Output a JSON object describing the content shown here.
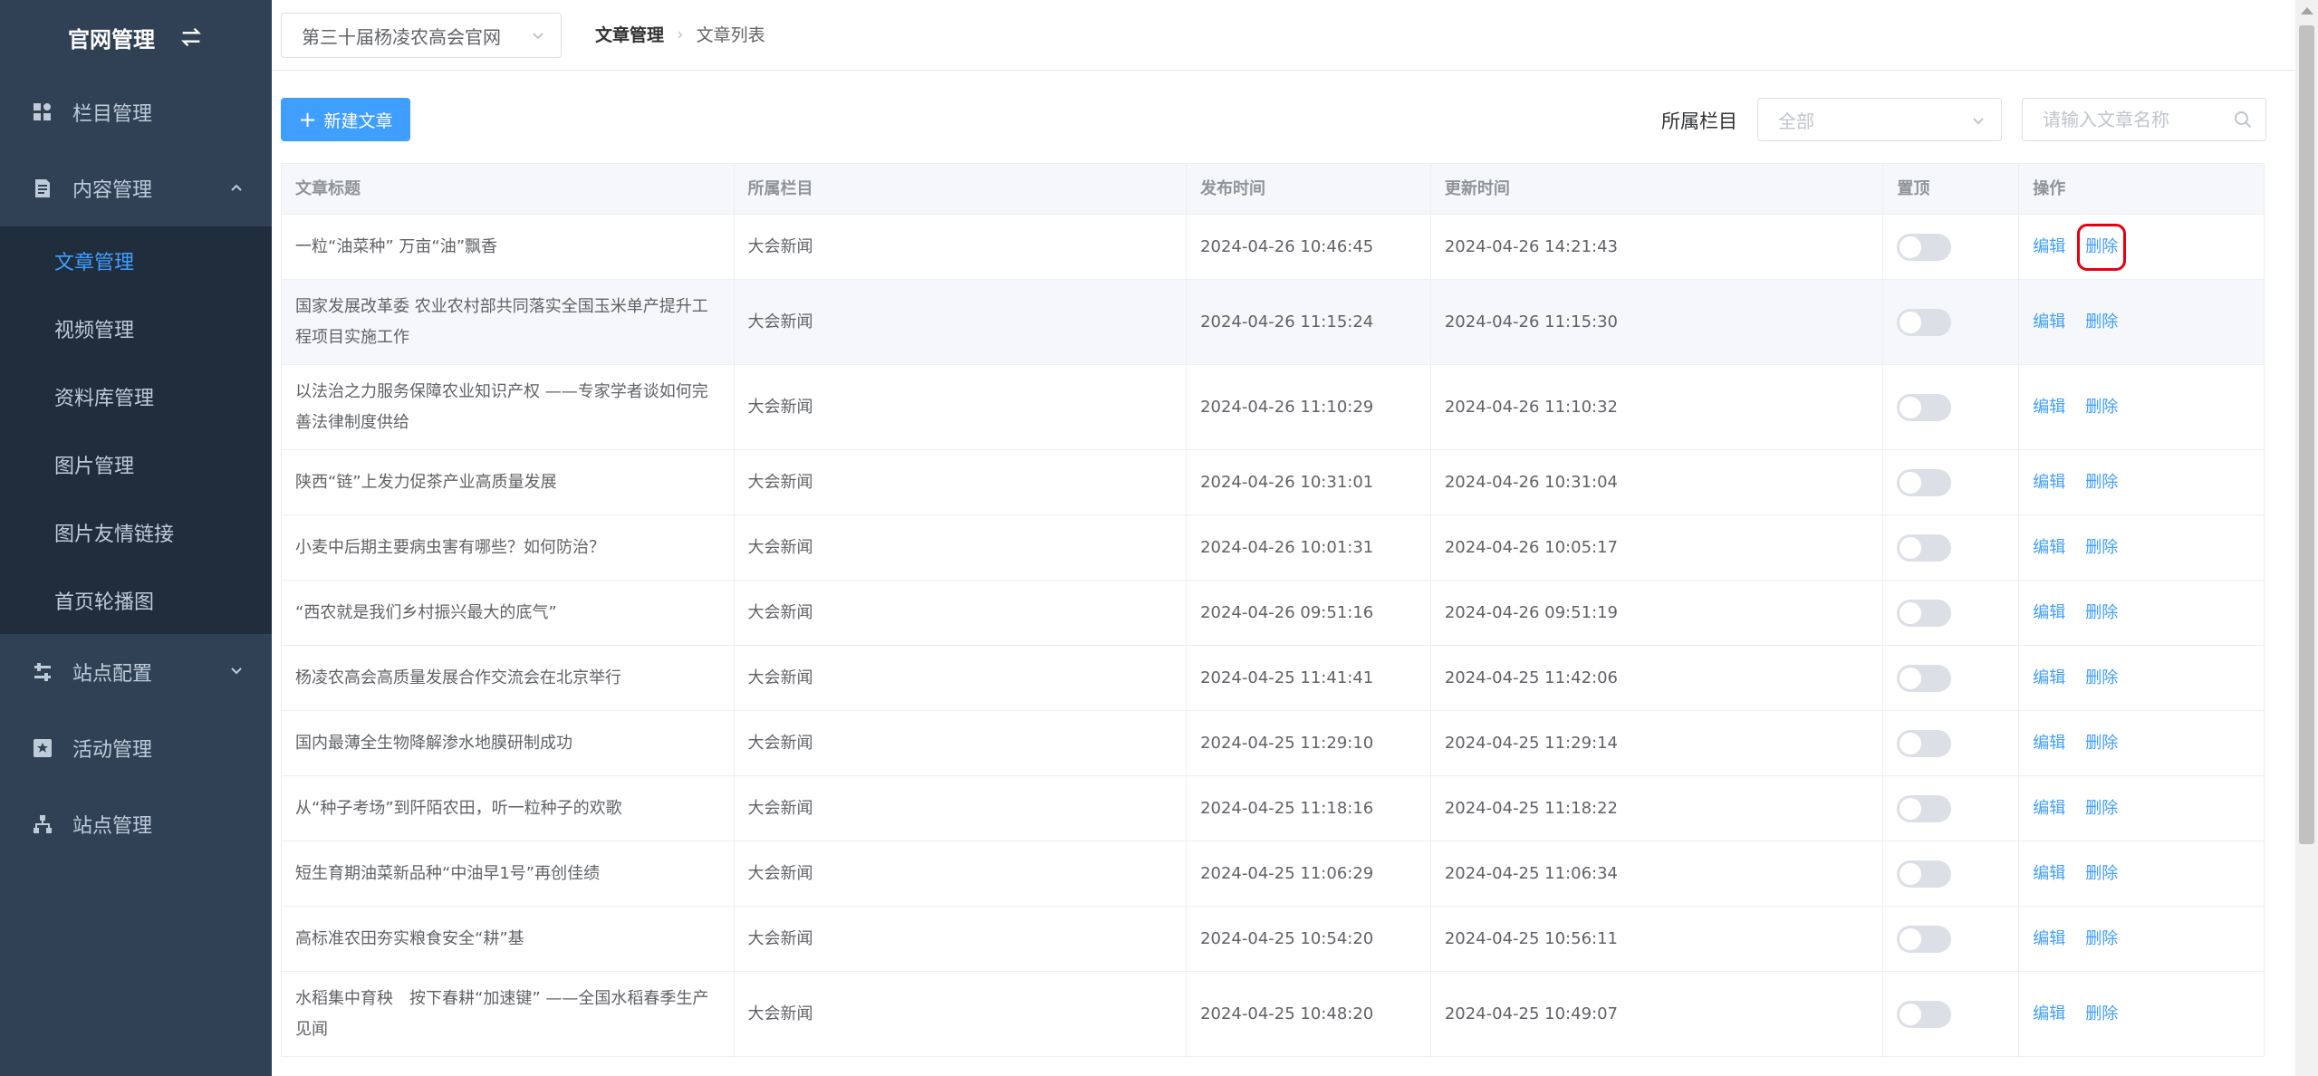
{
  "sidebar": {
    "title": "官网管理",
    "icons": {
      "swap": "swap-icon"
    },
    "menus": [
      {
        "label": "栏目管理",
        "icon": "grid-icon"
      },
      {
        "label": "内容管理",
        "icon": "document-icon"
      },
      {
        "label": "站点配置",
        "icon": "sliders-icon"
      },
      {
        "label": "活动管理",
        "icon": "star-box-icon"
      },
      {
        "label": "站点管理",
        "icon": "sitemap-icon"
      }
    ],
    "content_sub": [
      "文章管理",
      "视频管理",
      "资料库管理",
      "图片管理",
      "图片友情链接",
      "首页轮播图"
    ],
    "active_sub": "文章管理"
  },
  "topbar": {
    "site_select": "第三十届杨凌农高会官网",
    "breadcrumb": [
      "文章管理",
      "文章列表"
    ]
  },
  "toolbar": {
    "new_button": "新建文章",
    "filter_label": "所属栏目",
    "filter_value": "全部",
    "search_placeholder": "请输入文章名称"
  },
  "table": {
    "headers": [
      "文章标题",
      "所属栏目",
      "发布时间",
      "更新时间",
      "置顶",
      "操作"
    ],
    "edit_label": "编辑",
    "delete_label": "删除",
    "rows": [
      {
        "title": "一粒“油菜种” 万亩“油”飘香",
        "column": "大会新闻",
        "published": "2024-04-26 10:46:45",
        "updated": "2024-04-26 14:21:43",
        "pinned": false
      },
      {
        "title": "国家发展改革委 农业农村部共同落实全国玉米单产提升工程项目实施工作",
        "column": "大会新闻",
        "published": "2024-04-26 11:15:24",
        "updated": "2024-04-26 11:15:30",
        "pinned": false
      },
      {
        "title": "以法治之力服务保障农业知识产权 ——专家学者谈如何完善法律制度供给",
        "column": "大会新闻",
        "published": "2024-04-26 11:10:29",
        "updated": "2024-04-26 11:10:32",
        "pinned": false
      },
      {
        "title": "陕西“链”上发力促茶产业高质量发展",
        "column": "大会新闻",
        "published": "2024-04-26 10:31:01",
        "updated": "2024-04-26 10:31:04",
        "pinned": false
      },
      {
        "title": "小麦中后期主要病虫害有哪些？如何防治？",
        "column": "大会新闻",
        "published": "2024-04-26 10:01:31",
        "updated": "2024-04-26 10:05:17",
        "pinned": false
      },
      {
        "title": "“西农就是我们乡村振兴最大的底气”",
        "column": "大会新闻",
        "published": "2024-04-26 09:51:16",
        "updated": "2024-04-26 09:51:19",
        "pinned": false
      },
      {
        "title": "杨凌农高会高质量发展合作交流会在北京举行",
        "column": "大会新闻",
        "published": "2024-04-25 11:41:41",
        "updated": "2024-04-25 11:42:06",
        "pinned": false
      },
      {
        "title": "国内最薄全生物降解渗水地膜研制成功",
        "column": "大会新闻",
        "published": "2024-04-25 11:29:10",
        "updated": "2024-04-25 11:29:14",
        "pinned": false
      },
      {
        "title": "从“种子考场”到阡陌农田，听一粒种子的欢歌",
        "column": "大会新闻",
        "published": "2024-04-25 11:18:16",
        "updated": "2024-04-25 11:18:22",
        "pinned": false
      },
      {
        "title": "短生育期油菜新品种“中油早1号”再创佳绩",
        "column": "大会新闻",
        "published": "2024-04-25 11:06:29",
        "updated": "2024-04-25 11:06:34",
        "pinned": false
      },
      {
        "title": "高标准农田夯实粮食安全“耕”基",
        "column": "大会新闻",
        "published": "2024-04-25 10:54:20",
        "updated": "2024-04-25 10:56:11",
        "pinned": false
      },
      {
        "title": "水稻集中育秧　按下春耕“加速键” ——全国水稻春季生产见闻",
        "column": "大会新闻",
        "published": "2024-04-25 10:48:20",
        "updated": "2024-04-25 10:49:07",
        "pinned": false
      }
    ]
  },
  "colors": {
    "sidebar_bg": "#304156",
    "accent": "#409eff",
    "highlight_box": "#e60012"
  }
}
